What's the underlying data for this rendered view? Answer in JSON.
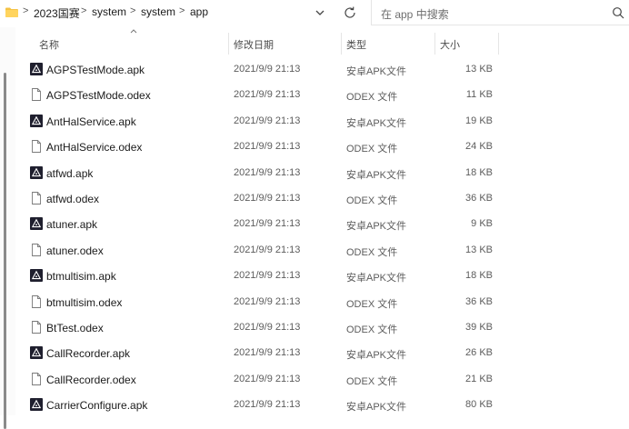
{
  "address": {
    "crumbs": [
      "2023国赛",
      "system",
      "system",
      "app"
    ],
    "separators": [
      ">",
      ">",
      ">",
      ">"
    ]
  },
  "search": {
    "placeholder": "在 app 中搜索"
  },
  "columns": {
    "name": "名称",
    "modified": "修改日期",
    "type": "类型",
    "size": "大小"
  },
  "files": [
    {
      "name": "AGPSTestMode.apk",
      "date": "2021/9/9 21:13",
      "type": "安卓APK文件",
      "size": "13 KB",
      "kind": "apk"
    },
    {
      "name": "AGPSTestMode.odex",
      "date": "2021/9/9 21:13",
      "type": "ODEX 文件",
      "size": "11 KB",
      "kind": "odex"
    },
    {
      "name": "AntHalService.apk",
      "date": "2021/9/9 21:13",
      "type": "安卓APK文件",
      "size": "19 KB",
      "kind": "apk"
    },
    {
      "name": "AntHalService.odex",
      "date": "2021/9/9 21:13",
      "type": "ODEX 文件",
      "size": "24 KB",
      "kind": "odex"
    },
    {
      "name": "atfwd.apk",
      "date": "2021/9/9 21:13",
      "type": "安卓APK文件",
      "size": "18 KB",
      "kind": "apk"
    },
    {
      "name": "atfwd.odex",
      "date": "2021/9/9 21:13",
      "type": "ODEX 文件",
      "size": "36 KB",
      "kind": "odex"
    },
    {
      "name": "atuner.apk",
      "date": "2021/9/9 21:13",
      "type": "安卓APK文件",
      "size": "9 KB",
      "kind": "apk"
    },
    {
      "name": "atuner.odex",
      "date": "2021/9/9 21:13",
      "type": "ODEX 文件",
      "size": "13 KB",
      "kind": "odex"
    },
    {
      "name": "btmultisim.apk",
      "date": "2021/9/9 21:13",
      "type": "安卓APK文件",
      "size": "18 KB",
      "kind": "apk"
    },
    {
      "name": "btmultisim.odex",
      "date": "2021/9/9 21:13",
      "type": "ODEX 文件",
      "size": "36 KB",
      "kind": "odex"
    },
    {
      "name": "BtTest.odex",
      "date": "2021/9/9 21:13",
      "type": "ODEX 文件",
      "size": "39 KB",
      "kind": "odex"
    },
    {
      "name": "CallRecorder.apk",
      "date": "2021/9/9 21:13",
      "type": "安卓APK文件",
      "size": "26 KB",
      "kind": "apk"
    },
    {
      "name": "CallRecorder.odex",
      "date": "2021/9/9 21:13",
      "type": "ODEX 文件",
      "size": "21 KB",
      "kind": "odex"
    },
    {
      "name": "CarrierConfigure.apk",
      "date": "2021/9/9 21:13",
      "type": "安卓APK文件",
      "size": "80 KB",
      "kind": "apk"
    }
  ],
  "icons": {
    "address": "folder-icon",
    "dropdown": "chevron-down-icon",
    "refresh": "refresh-icon",
    "search": "search-icon",
    "apk": "apk-file-icon",
    "odex": "blank-file-icon",
    "sort": "sort-up-icon"
  },
  "colors": {
    "folder": "#f5c242",
    "apk_icon": "#1f1f2e",
    "scrollbar": "#8a8a8a"
  }
}
